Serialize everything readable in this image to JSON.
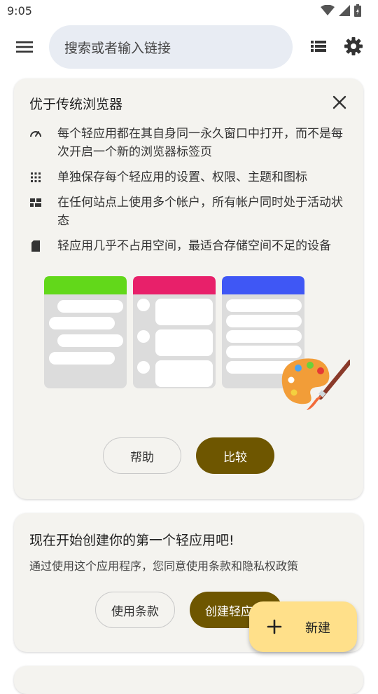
{
  "status_bar": {
    "time": "9:05"
  },
  "toolbar": {
    "search_placeholder": "搜索或者输入链接"
  },
  "info_card": {
    "title": "优于传统浏览器",
    "features": [
      {
        "icon": "speedometer-icon",
        "text": "每个轻应用都在其自身同一永久窗口中打开，而不是每次开启一个新的浏览器标签页"
      },
      {
        "icon": "grid-icon",
        "text": "单独保存每个轻应用的设置、权限、主题和图标"
      },
      {
        "icon": "accounts-icon",
        "text": "在任何站点上使用多个帐户，所有帐户同时处于活动状态"
      },
      {
        "icon": "sd-card-icon",
        "text": "轻应用几乎不占用空间，最适合存储空间不足的设备"
      }
    ],
    "help_label": "帮助",
    "compare_label": "比较",
    "colors": {
      "green": "#62d81a",
      "pink": "#e8206a",
      "blue": "#3f57f5",
      "filled_button": "#6e5600"
    }
  },
  "start_card": {
    "title": "现在开始创建你的第一个轻应用吧!",
    "subtitle": "通过使用这个应用程序，您同意使用条款和隐私权政策",
    "terms_label": "使用条款",
    "create_label": "创建轻应用"
  },
  "fab": {
    "label": "新建",
    "color": "#ffe08a"
  }
}
